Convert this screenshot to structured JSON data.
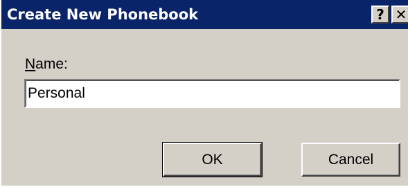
{
  "window": {
    "title": "Create New Phonebook",
    "help_button": "?",
    "close_button": "✕"
  },
  "form": {
    "name_label_mnemonic": "N",
    "name_label_rest": "ame:",
    "name_value": "Personal"
  },
  "buttons": {
    "ok_label": "OK",
    "cancel_label": "Cancel"
  },
  "colors": {
    "titlebar": "#0a246a",
    "face": "#d4d0c8"
  }
}
